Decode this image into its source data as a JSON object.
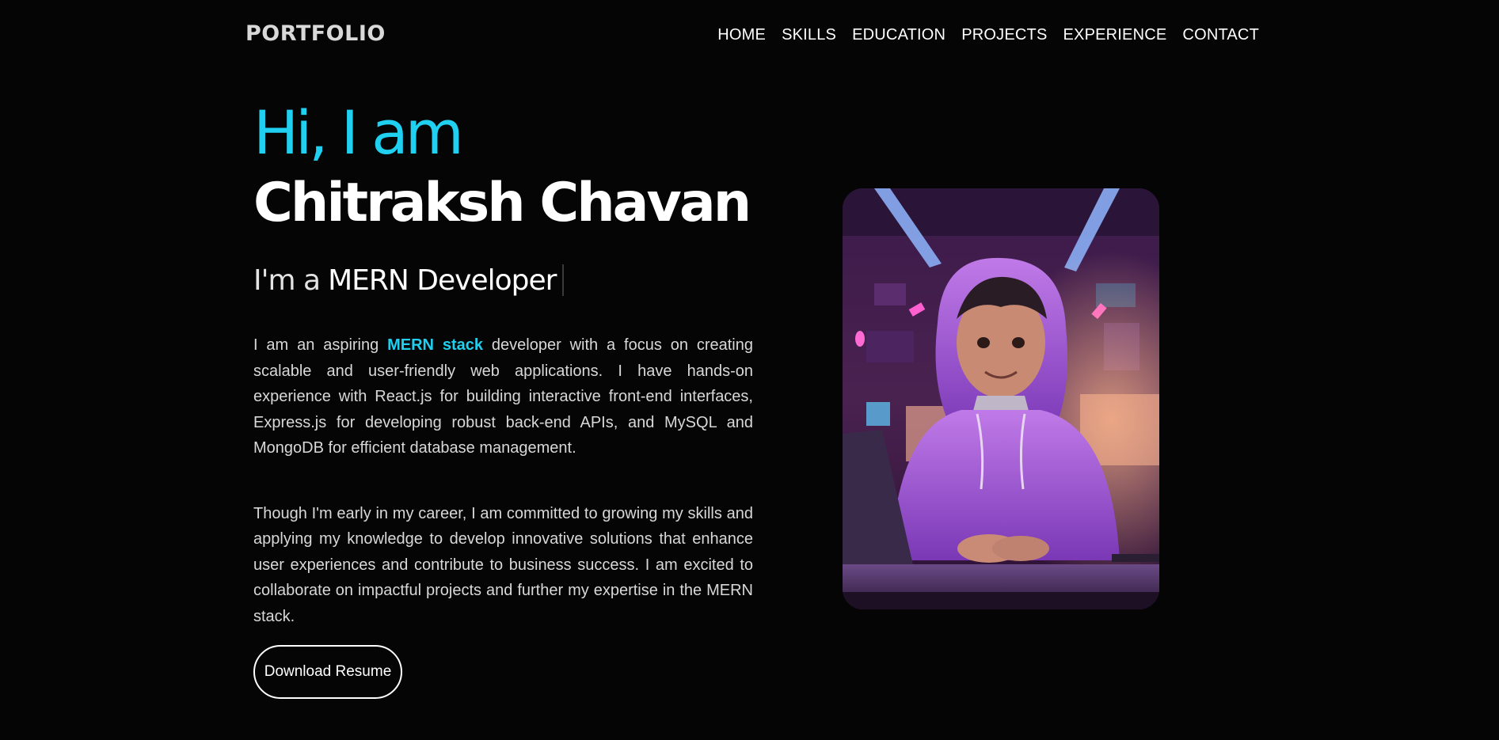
{
  "nav": {
    "logo": "PORTFOLIO",
    "links": [
      "HOME",
      "SKILLS",
      "EDUCATION",
      "PROJECTS",
      "EXPERIENCE",
      "CONTACT"
    ]
  },
  "hero": {
    "greeting": "Hi, I am",
    "name": "Chitraksh Chavan",
    "role_prefix": "I'm a",
    "role_typed": "MERN Developer",
    "para1_before": "I am an aspiring ",
    "para1_highlight": "MERN stack",
    "para1_after": " developer with a focus on creating scalable and user-friendly web applications. I have hands-on experience with React.js for building interactive front-end interfaces, Express.js for developing robust back-end APIs, and MySQL and MongoDB for efficient database management.",
    "para2": "Though I'm early in my career, I am committed to growing my skills and applying my knowledge to develop innovative solutions that enhance user experiences and contribute to business success. I am excited to collaborate on impactful projects and further my expertise in the MERN stack.",
    "button_label": "Download Resume"
  },
  "colors": {
    "accent": "#1fd0f0",
    "background": "#050506",
    "text": "#ffffff"
  },
  "icons": {
    "profile": "avatar-illustration"
  }
}
